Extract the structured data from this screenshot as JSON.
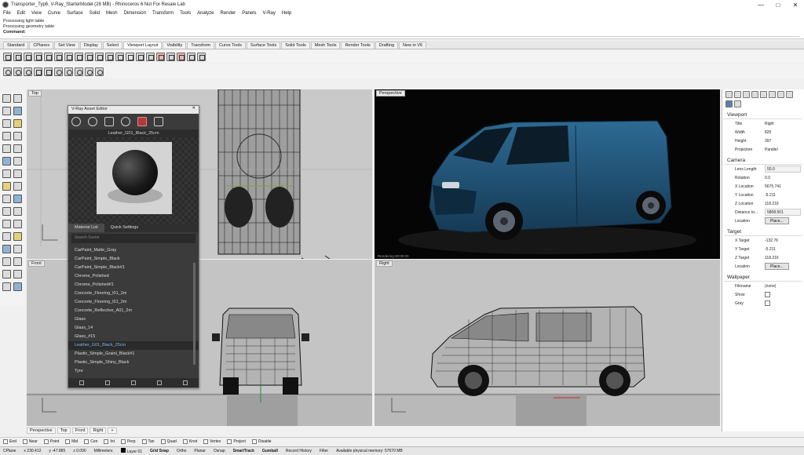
{
  "titlebar": {
    "title": "Transporter_Typ6, V-Ray_StarterModel (28 MB) - Rhinoceros 6 Not For Resale Lab",
    "minimize": "—",
    "maximize": "□",
    "close": "✕"
  },
  "menu": [
    "File",
    "Edit",
    "View",
    "Curve",
    "Surface",
    "Solid",
    "Mesh",
    "Dimension",
    "Transform",
    "Tools",
    "Analyze",
    "Render",
    "Panels",
    "V-Ray",
    "Help"
  ],
  "command": {
    "line1": "Processing light table",
    "line2": "Processing geometry table",
    "prompt": "Command:"
  },
  "toolbar_tabs": [
    "Standard",
    "CPlanes",
    "Set View",
    "Display",
    "Select",
    "Viewport Layout",
    "Visibility",
    "Transform",
    "Curve Tools",
    "Surface Tools",
    "Solid Tools",
    "Mesh Tools",
    "Render Tools",
    "Drafting",
    "New in V6"
  ],
  "active_toolbar_tab": "Viewport Layout",
  "viewports": {
    "top": "Top",
    "perspective": "Perspective",
    "front": "Front",
    "right": "Right",
    "render_status": "Rendering",
    "render_time": "00:00:00"
  },
  "asset_editor": {
    "title": "V-Ray Asset Editor",
    "close": "✕",
    "material_name": "Leather_G01_Black_25cm",
    "tabs": [
      "Material List",
      "Quick Settings"
    ],
    "search_placeholder": "Search Scene",
    "materials": [
      "CarPaint_Matte_Gray",
      "CarPaint_Simple_Black",
      "CarPaint_Simple_Black#1",
      "Chrome_Polished",
      "Chrome_Polished#1",
      "Concrete_Flooring_l01_2m",
      "Concrete_Flooring_l01_2m",
      "Concrete_Reflective_A01_2m",
      "Glass",
      "Glass_14",
      "Glass_#15",
      "Leather_G01_Black_25cm",
      "Plastic_Simple_Grainl_Black#1",
      "Plastic_Simple_Shiny_Black",
      "Tyre"
    ],
    "selected_material": "Leather_G01_Black_25cm"
  },
  "properties": {
    "viewport_section": "Viewport",
    "viewport": [
      {
        "k": "Title",
        "v": "Right"
      },
      {
        "k": "Width",
        "v": "825"
      },
      {
        "k": "Height",
        "v": "397"
      },
      {
        "k": "Projection",
        "v": "Parallel"
      }
    ],
    "camera_section": "Camera",
    "camera": [
      {
        "k": "Lens Length",
        "v": "50.0"
      },
      {
        "k": "Rotation",
        "v": "0.0"
      },
      {
        "k": "X Location",
        "v": "5675.741"
      },
      {
        "k": "Y Location",
        "v": "-5.211"
      },
      {
        "k": "Z Location",
        "v": "118.216"
      },
      {
        "k": "Distance to...",
        "v": "5808.501"
      }
    ],
    "location_label": "Location",
    "place_button": "Place...",
    "target_section": "Target",
    "target": [
      {
        "k": "X Target",
        "v": "-132.76"
      },
      {
        "k": "Y Target",
        "v": "-5.211"
      },
      {
        "k": "Z Target",
        "v": "118.216"
      }
    ],
    "wallpaper_section": "Wallpaper",
    "wallpaper": [
      {
        "k": "Filename",
        "v": "(none)"
      }
    ],
    "show_label": "Show",
    "gray_label": "Gray"
  },
  "viewport_tabs": [
    "Perspective",
    "Top",
    "Front",
    "Right",
    "+"
  ],
  "osnaps": [
    "End",
    "Near",
    "Point",
    "Mid",
    "Cen",
    "Int",
    "Perp",
    "Tan",
    "Quad",
    "Knot",
    "Vertex",
    "Project",
    "Disable"
  ],
  "status": {
    "cplane": "CPlane",
    "x": "x 230.412",
    "y": "y -47.885",
    "z": "z 0.000",
    "units": "Millimeters",
    "layer": "Layer 01",
    "grid_snap": "Grid Snap",
    "ortho": "Ortho",
    "planar": "Planar",
    "osnap": "Osnap",
    "smarttrack": "SmartTrack",
    "gumball": "Gumball",
    "record_history": "Record History",
    "filter": "Filter",
    "memory": "Available physical memory: 57670 MB"
  },
  "colors": {
    "van_body": "#1f4f73",
    "viewport_gray": "#c4c4c4",
    "perspective_bg": "#050505",
    "asset_editor_bg": "#3b3b3b",
    "selection_text": "#7fb8e6"
  }
}
